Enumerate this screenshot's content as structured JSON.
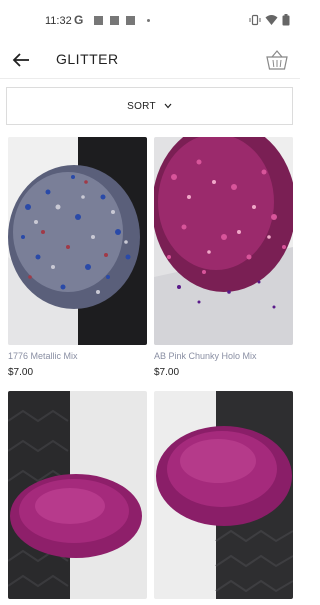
{
  "status_bar": {
    "time": "11:32",
    "g_icon": "G"
  },
  "header": {
    "title": "GLITTER",
    "back_icon": "arrow-left-icon",
    "cart_icon": "basket-icon"
  },
  "sort": {
    "label": "SORT",
    "icon": "chevron-down-icon"
  },
  "products": [
    {
      "name": "1776 Metallic Mix",
      "price": "$7.00"
    },
    {
      "name": "AB Pink Chunky Holo Mix",
      "price": "$7.00"
    },
    {
      "name": "",
      "price": ""
    },
    {
      "name": "",
      "price": ""
    }
  ],
  "colors": {
    "accent_text": "#8a8fa3",
    "divider": "#dcdcdc",
    "magenta": "#b0287e",
    "blue": "#2a4aa8"
  }
}
